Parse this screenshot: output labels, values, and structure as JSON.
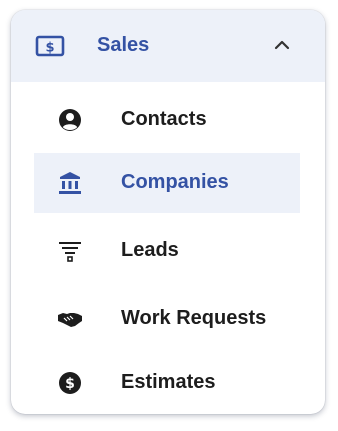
{
  "menu": {
    "header": {
      "label": "Sales",
      "icon": "dollar-bill-icon",
      "expanded_indicator": "chevron-up-icon"
    },
    "items": [
      {
        "label": "Contacts",
        "icon": "user-circle-icon",
        "active": false
      },
      {
        "label": "Companies",
        "icon": "bank-building-icon",
        "active": true
      },
      {
        "label": "Leads",
        "icon": "filter-funnel-icon",
        "active": false
      },
      {
        "label": "Work Requests",
        "icon": "handshake-icon",
        "active": false
      },
      {
        "label": "Estimates",
        "icon": "dollar-circle-icon",
        "active": false
      }
    ]
  },
  "colors": {
    "accent": "#3452a4",
    "active_background": "#edf1f9",
    "text": "#1d1d1d"
  }
}
